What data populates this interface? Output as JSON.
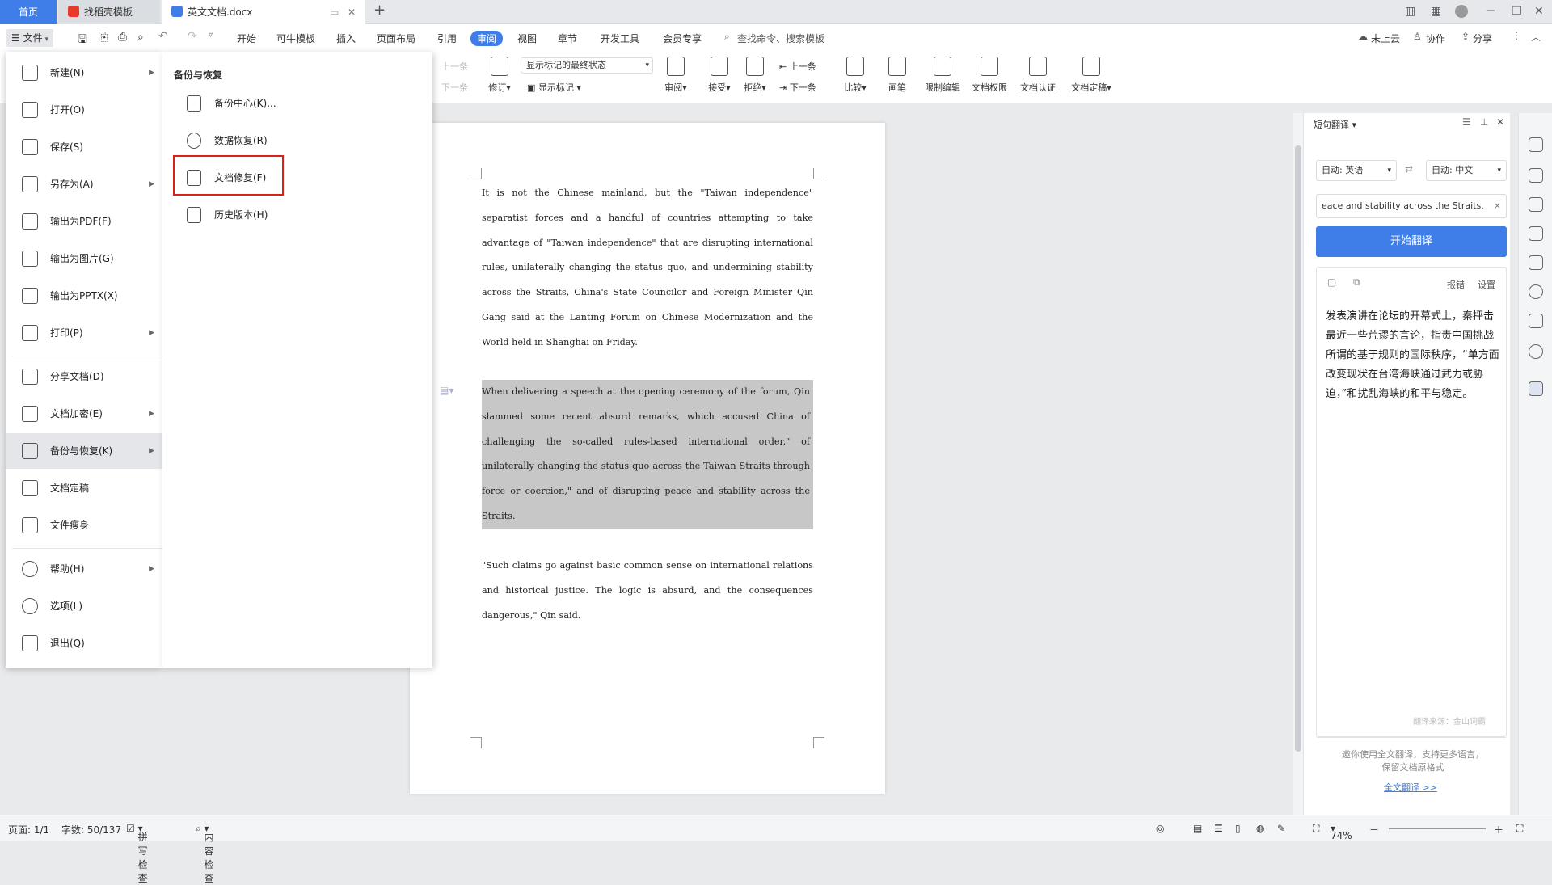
{
  "tabs": {
    "home": "首页",
    "templates": "找稻壳模板",
    "doc": "英文文档.docx",
    "new_tab": "+"
  },
  "menubar": {
    "file": "文件",
    "items": [
      "开始",
      "可牛模板",
      "插入",
      "页面布局",
      "引用",
      "审阅",
      "视图",
      "章节",
      "开发工具",
      "会员专享"
    ],
    "active": "审阅",
    "search_placeholder": "查找命令、搜索模板",
    "cloud": "未上云",
    "collab": "协作",
    "share": "分享"
  },
  "ribbon": {
    "prev": "上一条",
    "next": "下一条",
    "display_select": "显示标记的最终状态",
    "revise": "修订",
    "show_marks": "显示标记",
    "review": "审阅",
    "accept": "接受",
    "reject": "拒绝",
    "prev2": "上一条",
    "next2": "下一条",
    "compare": "比较",
    "pen": "画笔",
    "restrict": "限制编辑",
    "permission": "文档权限",
    "certify": "文档认证",
    "finalize": "文档定稿"
  },
  "filemenu": {
    "items": [
      {
        "label": "新建(N)",
        "arrow": true
      },
      {
        "label": "打开(O)",
        "arrow": false
      },
      {
        "label": "保存(S)",
        "arrow": false
      },
      {
        "label": "另存为(A)",
        "arrow": true
      },
      {
        "label": "输出为PDF(F)",
        "arrow": false
      },
      {
        "label": "输出为图片(G)",
        "arrow": false
      },
      {
        "label": "输出为PPTX(X)",
        "arrow": false
      },
      {
        "label": "打印(P)",
        "arrow": true
      },
      {
        "label": "分享文档(D)",
        "arrow": false
      },
      {
        "label": "文档加密(E)",
        "arrow": true
      },
      {
        "label": "备份与恢复(K)",
        "arrow": true
      },
      {
        "label": "文档定稿",
        "arrow": false
      },
      {
        "label": "文件瘦身",
        "arrow": false
      },
      {
        "label": "帮助(H)",
        "arrow": true
      },
      {
        "label": "选项(L)",
        "arrow": false
      },
      {
        "label": "退出(Q)",
        "arrow": false
      }
    ],
    "arrow_glyph": "▶"
  },
  "submenu": {
    "title": "备份与恢复",
    "items": [
      "备份中心(K)...",
      "数据恢复(R)",
      "文档修复(F)",
      "历史版本(H)"
    ]
  },
  "document": {
    "p1": "It is not the Chinese mainland, but the \"Taiwan independence\" separatist forces and a handful of countries attempting to take advantage of \"Taiwan independence\" that are disrupting international rules, unilaterally changing the status quo, and undermining stability across the Straits, China's State Councilor and Foreign Minister Qin Gang said at the Lanting Forum on Chinese Modernization and the World held in Shanghai on Friday.",
    "p2": "When delivering a speech at the opening ceremony of the forum, Qin slammed some recent absurd remarks, which accused China of challenging the so-called rules-based international order,\" of unilaterally changing the status quo across the Taiwan Straits through force or coercion,\" and of disrupting peace and stability across the Straits.",
    "p3": "\"Such claims go against basic common sense on international relations and historical justice. The logic is absurd, and the consequences dangerous,\" Qin said."
  },
  "translate": {
    "title": "短句翻译",
    "src_lang": "自动: 英语",
    "dst_lang": "自动: 中文",
    "input_value": "eace and stability across the Straits.",
    "button": "开始翻译",
    "report": "报错",
    "settings": "设置",
    "result": "发表演讲在论坛的开幕式上，秦抨击最近一些荒谬的言论，指责中国挑战所谓的基于规则的国际秩序，“单方面改变现状在台湾海峡通过武力或胁迫，”和扰乱海峡的和平与稳定。",
    "source": "翻译来源：金山词霸",
    "promo": "邀你使用全文翻译，支持更多语言，保留文档原格式",
    "full_link": "全文翻译 >>"
  },
  "status": {
    "page": "页面: 1/1",
    "words": "字数: 50/137",
    "spell": "拼写检查",
    "content": "内容检查",
    "zoom": "74%"
  },
  "colors": {
    "accent": "#3f7ee8",
    "highlight_box": "#d9201b"
  }
}
